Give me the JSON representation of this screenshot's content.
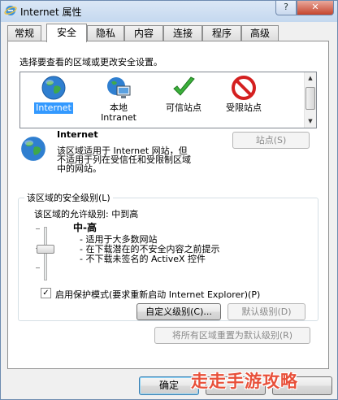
{
  "window": {
    "title": "Internet 属性"
  },
  "titlebar": {
    "help_symbol": "?",
    "close_symbol": "✕"
  },
  "tabs": [
    {
      "label": "常规"
    },
    {
      "label": "安全"
    },
    {
      "label": "隐私"
    },
    {
      "label": "内容"
    },
    {
      "label": "连接"
    },
    {
      "label": "程序"
    },
    {
      "label": "高级"
    }
  ],
  "active_tab": "安全",
  "security": {
    "instruction": "选择要查看的区域或更改安全设置。",
    "zones": [
      {
        "label": "Internet",
        "icon": "globe-icon",
        "selected": true
      },
      {
        "label": "本地\nIntranet",
        "icon": "intranet-icon",
        "selected": false
      },
      {
        "label": "可信站点",
        "icon": "checkmark-icon",
        "selected": false
      },
      {
        "label": "受限站点",
        "icon": "restricted-icon",
        "selected": false
      }
    ],
    "selected_zone": {
      "name": "Internet",
      "description": "该区域适用于 Internet 网站，但\n不适用于列在受信任和受限制区域\n中的网站。",
      "sites_button": "站点(S)"
    },
    "level_group": {
      "legend": "该区域的安全级别(L)",
      "allowed_levels": "该区域的允许级别: 中到高",
      "level_name": "中-高",
      "level_details": [
        "- 适用于大多数网站",
        "- 在下载潜在的不安全内容之前提示",
        "- 不下载未签名的 ActiveX 控件"
      ],
      "level_fraction": 0.67,
      "protected_mode_label": "启用保护模式(要求重新启动 Internet Explorer)(P)",
      "protected_mode_checked": true,
      "custom_level_button": "自定义级别(C)...",
      "default_level_button": "默认级别(D)"
    },
    "reset_all_button": "将所有区域重置为默认级别(R)"
  },
  "footer": {
    "ok_button": "确定"
  },
  "watermark": "走走手游攻略",
  "colors": {
    "selection": "#3399ff",
    "watermark": "#e8503a"
  }
}
